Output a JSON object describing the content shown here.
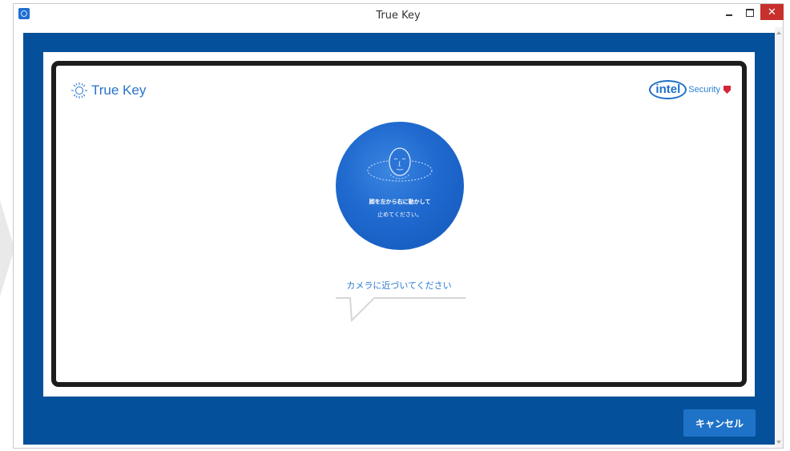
{
  "window": {
    "title": "True Key"
  },
  "logo": {
    "text": "True Key"
  },
  "brand": {
    "intel": "intel",
    "security": "Security"
  },
  "face_scan": {
    "instruction_line1": "顔を左から右に動かして",
    "instruction_line2": "止めてください。",
    "hint": "カメラに近づいてください"
  },
  "footer": {
    "cancel_label": "キャンセル"
  },
  "icons": {
    "app": "true-key-app-icon",
    "logo": "true-key-logo-icon",
    "face": "face-outline-icon",
    "shield": "shield-icon"
  },
  "colors": {
    "client_bg": "#05509a",
    "accent_blue": "#1e73c8",
    "circle_blue": "#1f69cf",
    "close_red": "#c7302b"
  }
}
